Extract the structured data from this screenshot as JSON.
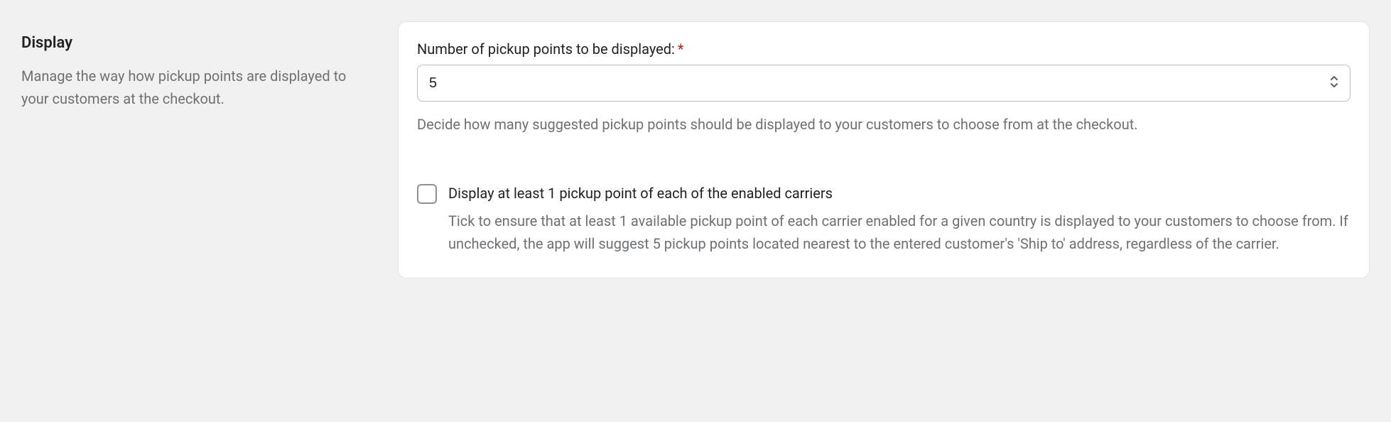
{
  "section": {
    "title": "Display",
    "description": "Manage the way how pickup points are displayed to your customers at the checkout."
  },
  "pickupCount": {
    "label": "Number of pickup points to be displayed:",
    "required_marker": "*",
    "value": "5",
    "help": "Decide how many suggested pickup points should be displayed to your customers to choose from at the checkout."
  },
  "ensureOnePerCarrier": {
    "checked": false,
    "label": "Display at least 1 pickup point of each of the enabled carriers",
    "help": "Tick to ensure that at least 1 available pickup point of each carrier enabled for a given country is displayed to your customers to choose from. If unchecked, the app will suggest 5 pickup points located nearest to the entered customer's 'Ship to' address, regardless of the carrier."
  }
}
